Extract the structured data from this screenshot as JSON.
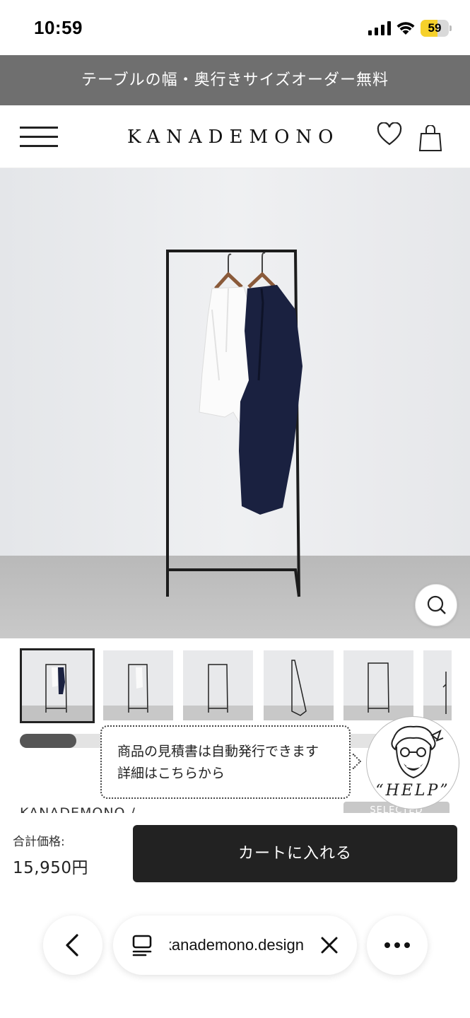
{
  "status_bar": {
    "time": "10:59",
    "battery_level": 59,
    "battery_text": "59",
    "battery_color": "#f6d12b"
  },
  "banner": {
    "text": "テーブルの幅・奥行きサイズオーダー無料"
  },
  "header": {
    "logo": "KANADEMONO",
    "menu_icon": "hamburger-icon",
    "favorite_icon": "heart-icon",
    "cart_icon": "shopping-bag-icon"
  },
  "gallery": {
    "zoom_icon": "search-icon",
    "thumbnail_count": 6,
    "active_index": 0,
    "scroll_position": 0.13
  },
  "tooltip": {
    "line1": "商品の見積書は自動発行できます",
    "line2": "詳細はこちらから"
  },
  "help": {
    "label": "“HELP”"
  },
  "product": {
    "brand": "KANADEMONO /",
    "selected_badge": "SELECTED"
  },
  "purchase": {
    "total_label": "合計価格:",
    "total_price": "15,950円",
    "add_to_cart": "カートに入れる",
    "button_color": "#222222"
  },
  "browser": {
    "url": "kanademono.design",
    "back_icon": "chevron-left-icon",
    "tabs_icon": "tabs-icon",
    "clear_icon": "close-icon",
    "more_icon": "more-horizontal-icon"
  }
}
